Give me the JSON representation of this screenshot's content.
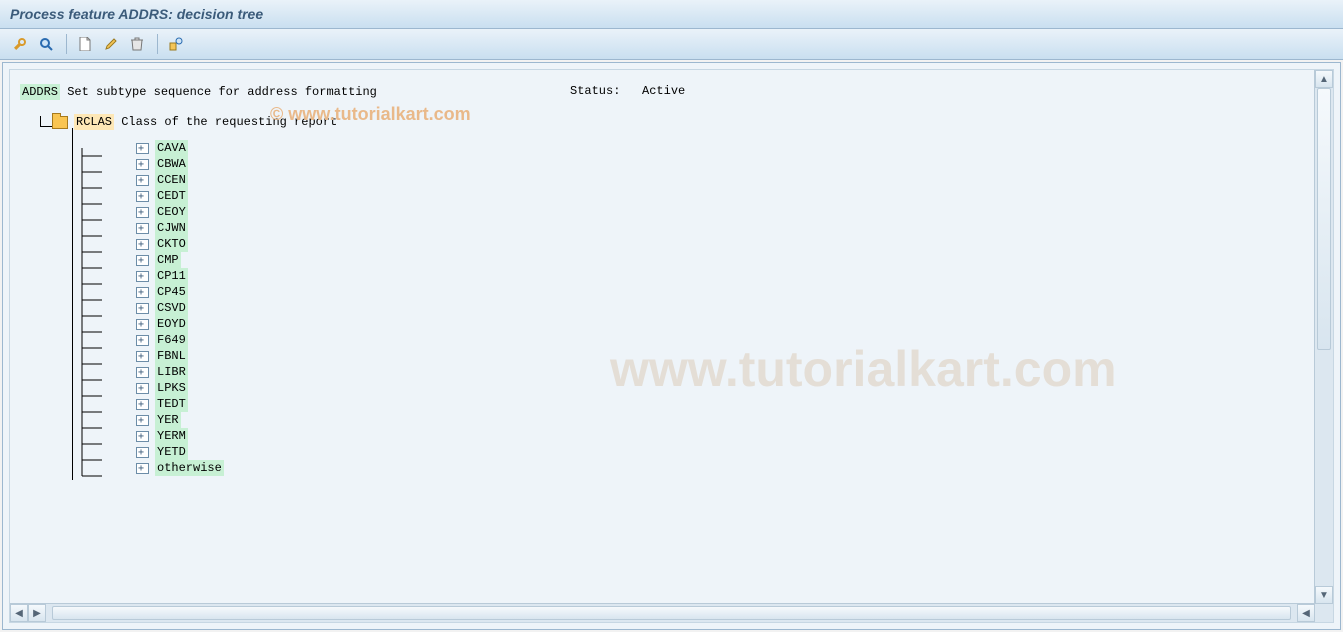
{
  "title": "Process feature ADDRS: decision tree",
  "watermark_small": "© www.tutorialkart.com",
  "watermark_big": "www.tutorialkart.com",
  "toolbar": {
    "tools_icon": "tools",
    "inspect_icon": "inspect",
    "new_icon": "new",
    "edit_icon": "edit",
    "delete_icon": "delete",
    "detail_icon": "detail"
  },
  "root": {
    "code": "ADDRS",
    "desc": "Set subtype sequence for address formatting"
  },
  "status_label": "Status:",
  "status_value": "Active",
  "child": {
    "code": "RCLAS",
    "desc": "Class of the requesting report"
  },
  "leaves": [
    "CAVA",
    "CBWA",
    "CCEN",
    "CEDT",
    "CEOY",
    "CJWN",
    "CKTO",
    "CMP",
    "CP11",
    "CP45",
    "CSVD",
    "EOYD",
    "F649",
    "FBNL",
    "LIBR",
    "LPKS",
    "TEDT",
    "YER",
    "YERM",
    "YETD",
    "otherwise"
  ]
}
